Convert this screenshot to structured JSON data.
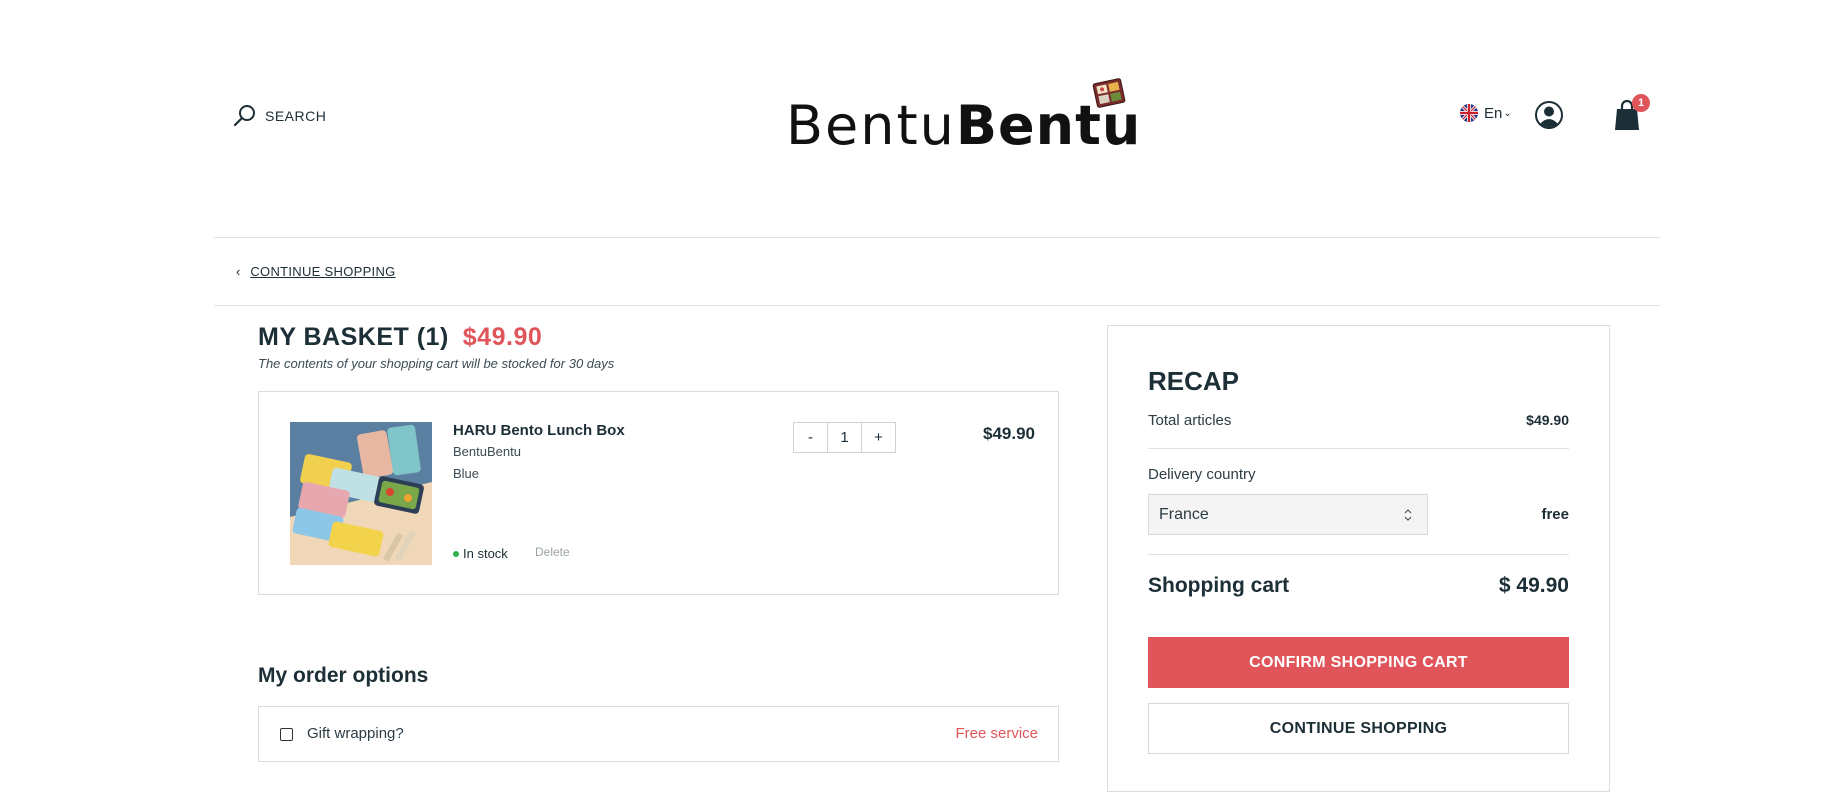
{
  "header": {
    "search_label": "SEARCH",
    "logo_text_light": "Bentu",
    "logo_text_bold": "Bentu",
    "language": "En",
    "cart_count": "1"
  },
  "nav": {
    "continue_shopping": "CONTINUE SHOPPING"
  },
  "basket": {
    "title": "MY BASKET (1)",
    "total": "$49.90",
    "note": "The contents of your shopping cart will be stocked for 30 days",
    "item": {
      "name": "HARU Bento Lunch Box",
      "brand": "BentuBentu",
      "color": "Blue",
      "quantity": "1",
      "minus": "-",
      "plus": "+",
      "price": "$49.90",
      "stock": "In stock",
      "delete": "Delete"
    }
  },
  "order_options": {
    "title": "My order options",
    "gift_label": "Gift wrapping?",
    "gift_price": "Free service"
  },
  "recap": {
    "title": "RECAP",
    "total_articles_label": "Total articles",
    "total_articles_value": "$49.90",
    "delivery_country_label": "Delivery country",
    "delivery_country_value": "France",
    "delivery_cost": "free",
    "shopping_cart_label": "Shopping cart",
    "shopping_cart_value": "$ 49.90",
    "confirm_button": "CONFIRM SHOPPING CART",
    "continue_button": "CONTINUE SHOPPING"
  },
  "colors": {
    "accent": "#e0555a",
    "text": "#1c2e36",
    "in_stock": "#2eb14a"
  }
}
